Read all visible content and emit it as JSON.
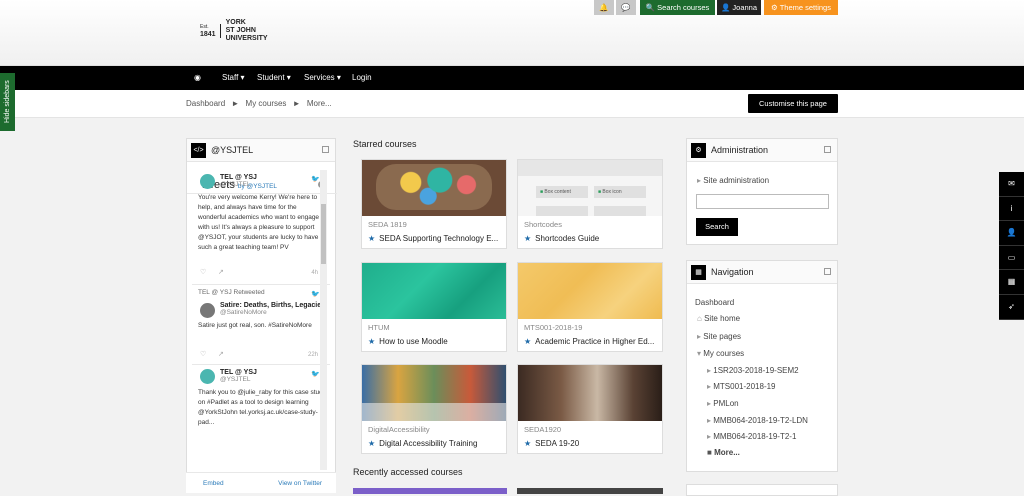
{
  "header": {
    "logo_est": "Est.",
    "logo_year": "1841",
    "logo_name_1": "YORK",
    "logo_name_2": "ST JOHN",
    "logo_name_3": "UNIVERSITY",
    "search_courses": "Search courses",
    "user": "Joanna",
    "theme_settings": "Theme settings"
  },
  "nav": {
    "staff": "Staff",
    "student": "Student",
    "services": "Services",
    "login": "Login"
  },
  "breadcrumb": {
    "dashboard": "Dashboard",
    "my_courses": "My courses",
    "more": "More...",
    "sep": "►"
  },
  "customise": "Customise this page",
  "hide_sidebars": "Hide sidebars",
  "twitter_block": {
    "title": "@YSJTEL",
    "tweets_title": "Tweets",
    "by": "by",
    "by_handle": "@YSJTEL",
    "tweets": [
      {
        "who": "TEL @ YSJ",
        "handle": "@YSJTEL",
        "text": "You're very welcome Kerry! We're here to help, and always have time for the wonderful academics who want to engage with us! It's always a pleasure to support @YSJOT, your students are lucky to have such a great teaching team! PV",
        "count": "4h"
      },
      {
        "retweet": "TEL @ YSJ Retweeted",
        "who": "Satire: Deaths, Births, Legacie",
        "handle": "@SatireNoMore",
        "text": "Satire just got real, son. #SatireNoMore",
        "count": "22h"
      },
      {
        "who": "TEL @ YSJ",
        "handle": "@YSJTEL",
        "text": "Thank you to @julie_raby for this case study on #Padlet as a tool to design learning @YorkStJohn tel.yorksj.ac.uk/case-study-pad..."
      }
    ],
    "embed": "Embed",
    "view_on_twitter": "View on Twitter"
  },
  "starred": {
    "heading": "Starred courses",
    "courses": [
      {
        "category": "SEDA 1819",
        "name": "SEDA Supporting Technology E..."
      },
      {
        "category": "Shortcodes",
        "name": "Shortcodes Guide",
        "box1": "Box content",
        "box2": "Box icon"
      },
      {
        "category": "HTUM",
        "name": "How to use Moodle"
      },
      {
        "category": "MTS001-2018-19",
        "name": "Academic Practice in Higher Ed..."
      },
      {
        "category": "DigitalAccessibility",
        "name": "Digital Accessibility Training"
      },
      {
        "category": "SEDA1920",
        "name": "SEDA 19-20"
      }
    ]
  },
  "recent": {
    "heading": "Recently accessed courses"
  },
  "administration": {
    "title": "Administration",
    "site_admin": "Site administration",
    "search_button": "Search"
  },
  "navigation": {
    "title": "Navigation",
    "dashboard": "Dashboard",
    "site_home": "Site home",
    "site_pages": "Site pages",
    "my_courses": "My courses",
    "courses": [
      "1SR203-2018-19-SEM2",
      "MTS001-2018-19",
      "PMLon",
      "MMB064-2018-19-T2-LDN",
      "MMB064-2018-19-T2-1"
    ],
    "more": "More..."
  },
  "colors": {
    "topbar_green": "#1d6b2e",
    "theme_orange": "#f7931e",
    "nav_black": "#000000",
    "star_blue": "#1e6aa8"
  }
}
